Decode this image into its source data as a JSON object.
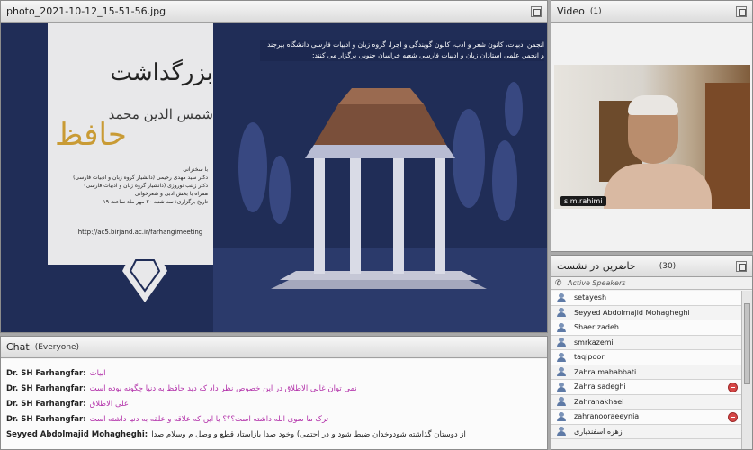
{
  "photo_pod": {
    "title": "photo_2021-10-12_15-51-56.jpg",
    "poster": {
      "title": "بزرگداشت",
      "subtitle": "شمس الدین محمد",
      "hafez": "حافظ",
      "banner_line1": "انجمن ادبیات، کانون شعر و ادب، کانون گویندگی و اجرا، گروه زبان و ادبیات فارسی دانشگاه بیرجند",
      "banner_line2": "و انجمن علمی استادان زبان و ادبیات فارسی شعبه خراسان جنوبی برگزار می کنند:",
      "lines": [
        "با سخنرانی",
        "دکتر سید مهدی رحیمی (دانشیار گروه زبان و ادبیات فارسی)",
        "دکتر زینب نوروزی (دانشیار گروه زبان و ادبیات فارسی)",
        "همراه با بخش ادبی و شعرخوانی",
        "تاریخ برگزاری: سه شنبه ۲۰ مهر ماه ساعت ۱۹"
      ],
      "url": "http://ac5.birjand.ac.ir/farhangimeeting"
    }
  },
  "video_pod": {
    "title": "Video",
    "count": "(1)",
    "participant_name": "s.m.rahimi"
  },
  "attendees_pod": {
    "title": "حاضرین در نشست",
    "count": "(30)",
    "active_speakers_label": "Active Speakers",
    "attendees": [
      {
        "name": "setayesh",
        "status": ""
      },
      {
        "name": "Seyyed Abdolmajid Mohagheghi",
        "status": ""
      },
      {
        "name": "Shaer zadeh",
        "status": ""
      },
      {
        "name": "smrkazemi",
        "status": ""
      },
      {
        "name": "taqipoor",
        "status": ""
      },
      {
        "name": "Zahra mahabbati",
        "status": ""
      },
      {
        "name": "Zahra sadeghi",
        "status": "away"
      },
      {
        "name": "Zahranakhaei",
        "status": ""
      },
      {
        "name": "zahranooraeeynia",
        "status": "away"
      },
      {
        "name": "زهره اسفندیاری",
        "status": ""
      }
    ]
  },
  "chat_pod": {
    "title": "Chat",
    "scope": "(Everyone)",
    "messages": [
      {
        "sender": "Dr. SH Farhangfar:",
        "text": "ابیات",
        "color": "#b22fa9"
      },
      {
        "sender": "Dr. SH Farhangfar:",
        "text": "نمی توان غالی الاطلاق در این خصوص نظر داد که دید حافظ به دنیا چگونه بوده است",
        "color": "#b22fa9"
      },
      {
        "sender": "Dr. SH Farhangfar:",
        "text": "علی الاطلاق",
        "color": "#b22fa9"
      },
      {
        "sender": "Dr. SH Farhangfar:",
        "text": "ترک ما سوی الله داشته است؟؟؟ یا این که علاقه و علقه به دنیا داشته است",
        "color": "#b22fa9"
      },
      {
        "sender": "Seyyed Abdolmajid Mohagheghi:",
        "text": "از دوستان گذاشته شودوخدان ضبط شود و در احتمی) وخود صدا بازاستاد قطع و وصل م وسلام صدا",
        "color": "#222222"
      }
    ]
  }
}
